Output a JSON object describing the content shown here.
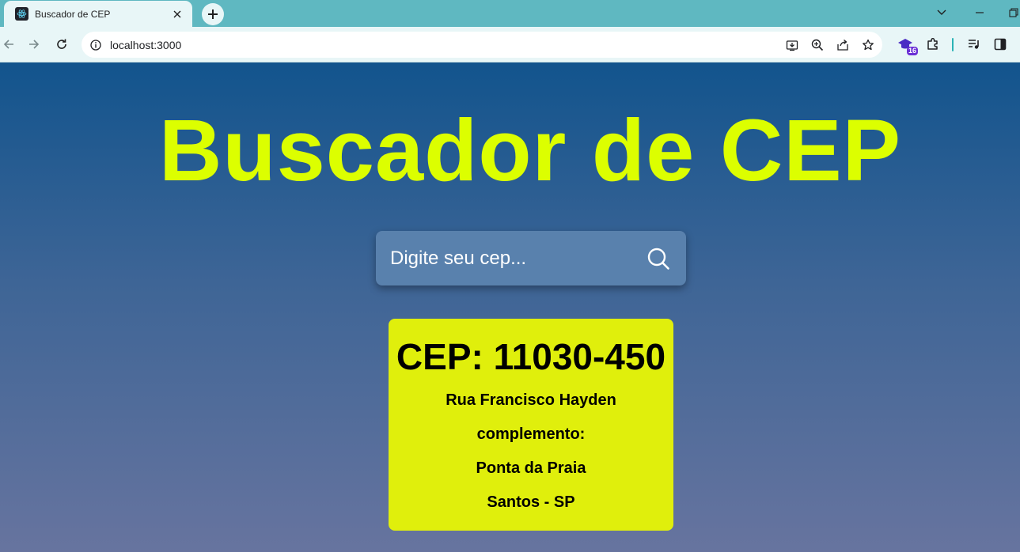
{
  "browser": {
    "tab": {
      "title": "Buscador de CEP",
      "favicon": "react-icon"
    },
    "address": {
      "url": "localhost:3000"
    },
    "extension_badge": "16"
  },
  "page": {
    "title": "Buscador de CEP",
    "search": {
      "placeholder": "Digite seu cep...",
      "value": ""
    },
    "result": {
      "cep_line": "CEP: 11030-450",
      "street": "Rua Francisco Hayden",
      "complement": "complemento:",
      "neighborhood": "Ponta da Praia",
      "city_state": "Santos - SP"
    }
  },
  "colors": {
    "title": "#dcff00",
    "card": "#e0ef0c",
    "search_bg": "#5981ad",
    "gradient_top": "#12548d",
    "gradient_bottom": "#67749f",
    "chrome_frame": "#5fb8c1"
  }
}
